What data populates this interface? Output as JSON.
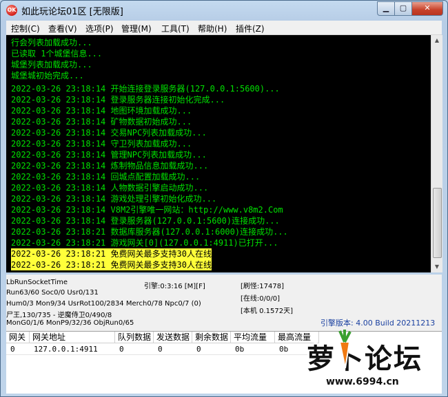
{
  "window": {
    "title": "如此玩论坛01区 [无限版]",
    "icon_text": "OK"
  },
  "window_buttons": {
    "minimize": "▁",
    "maximize": "▢",
    "close": "✕"
  },
  "menu": [
    "控制(C)",
    "查看(V)",
    "选项(P)",
    "管理(M)",
    "工具(T)",
    "帮助(H)",
    "插件(Z)"
  ],
  "console_lines": [
    "行会列表加载成功...",
    "已读取 1个城堡信息...",
    "城堡列表加载成功...",
    "城堡城初始完成...",
    "2022-03-26 23:18:14 开始连接登录服务器(127.0.0.1:5600)...",
    "2022-03-26 23:18:14 登录服务器连接初始化完成...",
    "2022-03-26 23:18:14 地图环境加载成功...",
    "2022-03-26 23:18:14 矿物数据初始成功...",
    "2022-03-26 23:18:14 交易NPC列表加载成功...",
    "2022-03-26 23:18:14 守卫列表加载成功...",
    "2022-03-26 23:18:14 管理NPC列表加载成功...",
    "2022-03-26 23:18:14 炼制物品信息加载成功...",
    "2022-03-26 23:18:14 回城点配置加载成功...",
    "2022-03-26 23:18:14 人物数据引擎启动成功...",
    "2022-03-26 23:18:14 游戏处理引擎初始化成功...",
    "2022-03-26 23:18:14 V8M2引擎唯一网站：http://www.v8m2.Com",
    "2022-03-26 23:18:14 登录服务器(127.0.0.1:5600)连接成功...",
    "2022-03-26 23:18:21 数据库服务器(127.0.0.1:6000)连接成功...",
    "2022-03-26 23:18:21 游戏网关[0](127.0.0.1:4911)已打开..."
  ],
  "console_highlight_lines": [
    "2022-03-26 23:18:21 免费网关最多支持30人在线",
    "2022-03-26 23:18:21 免费网关最多支持30人在线"
  ],
  "status": {
    "socket": "LbRunSocketTime",
    "engine": "引擎:0:3:16 [M][F]",
    "refresh": "[刷怪:17478]",
    "run": "Run63/60 Soc0/0 Usr0/131",
    "online": "[在线:0/0/0]",
    "hum": "Hum0/3 Mon9/34 UsrRot100/2834 Merch0/78 Npc0/7 (0)",
    "local": "[本机 0.1572天]",
    "household": "尸王,130/735 - 逆魔侍卫0/490/8",
    "mongo": "MonG0/1/6 MonP9/32/36 ObjRun0/65",
    "version": "引擎版本: 4.00 Build 20211213"
  },
  "grid": {
    "headers": [
      "网关",
      "网关地址",
      "队列数据",
      "发送数据",
      "剩余数据",
      "平均流量",
      "最高流量"
    ],
    "rows": [
      [
        "0",
        "127.0.0.1:4911",
        "0",
        "0",
        "0",
        "0b",
        "0b"
      ]
    ]
  },
  "watermark": {
    "text": "萝卜论坛",
    "url": "www.6994.cn"
  }
}
